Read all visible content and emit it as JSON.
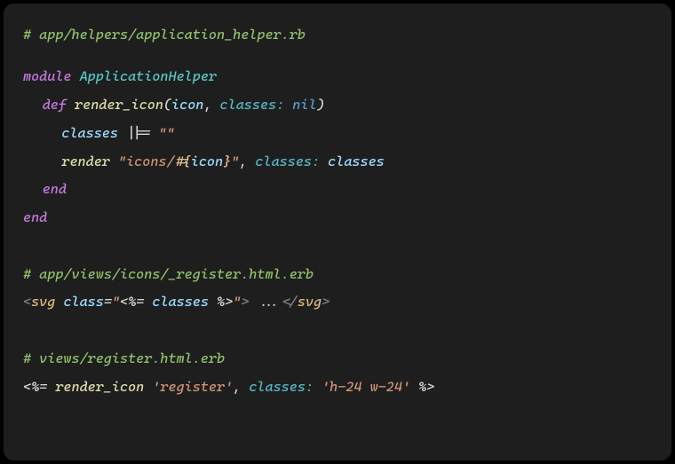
{
  "code": {
    "c1": "# app/helpers/application_helper.rb",
    "kw_module": "module",
    "cls": "ApplicationHelper",
    "kw_def": "def",
    "fn_render_icon": "render_icon",
    "lparen": "(",
    "param_icon": "icon",
    "comma": ", ",
    "kwarg_classes": "classes:",
    "sp": " ",
    "const_nil": "nil",
    "rparen": ")",
    "assign_line_var": "classes",
    "op_or_assign": " ||= ",
    "str_empty": "\"\"",
    "fn_render": "render",
    "str_icons_open": "\"icons/",
    "interp_open": "#{",
    "interp_var": "icon",
    "interp_close": "}",
    "str_close_quote": "\"",
    "kw_end": "end",
    "c2": "# app/views/icons/_register.html.erb",
    "lt": "<",
    "tag_svg": "svg",
    "attr_class": "class",
    "eq": "=",
    "dq": "\"",
    "erb_open_out": "<%=",
    "erb_expr_classes": " classes ",
    "erb_close": "%>",
    "gt": ">",
    "svg_inner": " ...",
    "lt_slash": "</",
    "c3": "# views/register.html.erb",
    "call_render_icon": " render_icon ",
    "str_register": "'register'",
    "str_hw": "'h-24 w-24'",
    "erb_close2": " %>"
  }
}
